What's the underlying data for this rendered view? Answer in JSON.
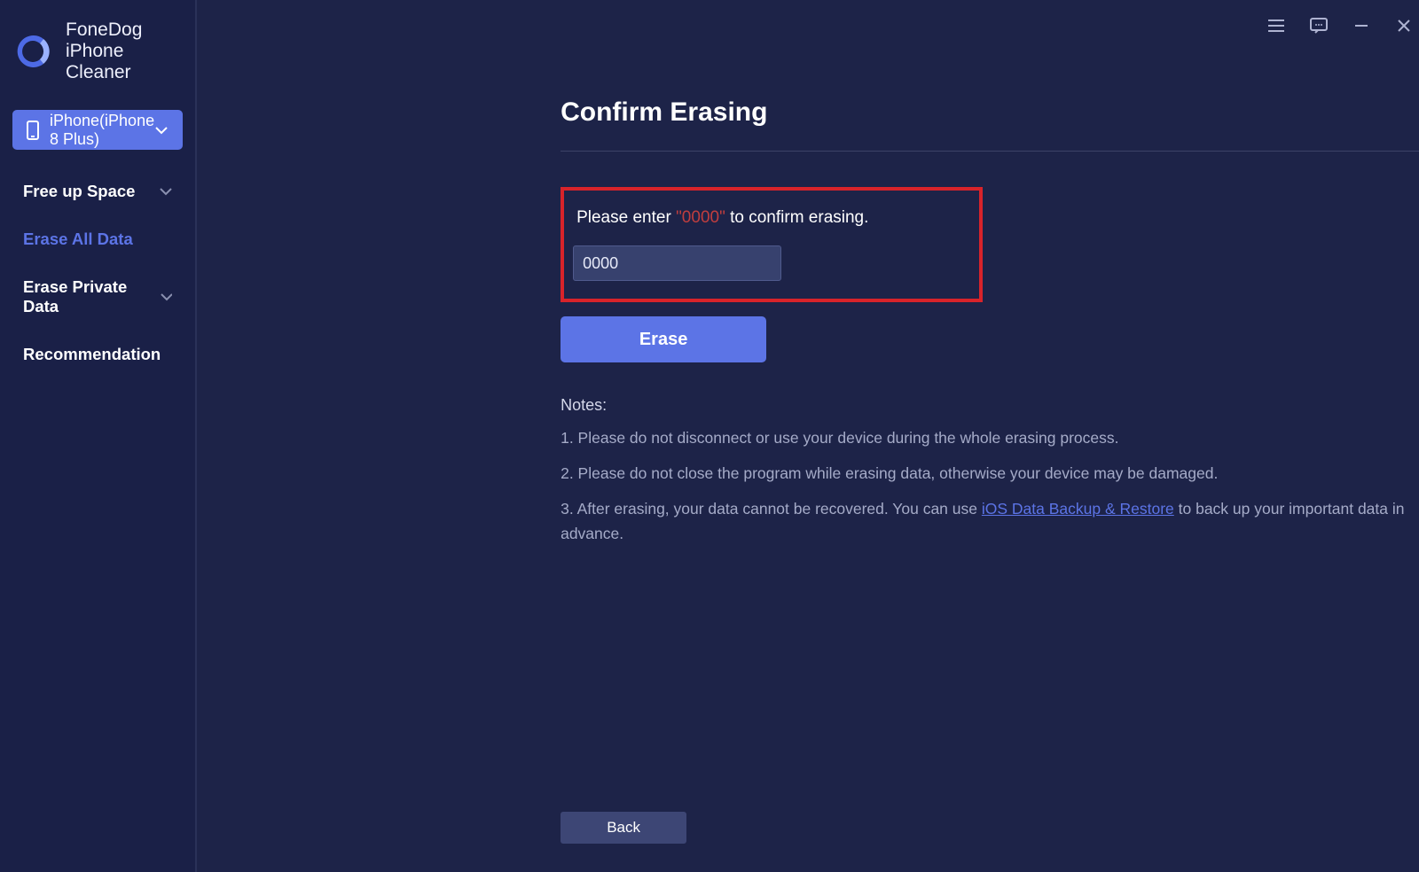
{
  "brand": {
    "title": "FoneDog iPhone Cleaner"
  },
  "device": {
    "label": "iPhone(iPhone 8 Plus)"
  },
  "nav": {
    "freeup": "Free up Space",
    "eraseAll": "Erase All Data",
    "erasePrivate": "Erase Private Data",
    "recommend": "Recommendation"
  },
  "page": {
    "title": "Confirm Erasing"
  },
  "prompt": {
    "pre": "Please enter ",
    "code": "\"0000\"",
    "post": " to confirm erasing."
  },
  "input": {
    "value": "0000"
  },
  "buttons": {
    "erase": "Erase",
    "back": "Back"
  },
  "notes": {
    "title": "Notes:",
    "n1": "1. Please do not disconnect or use your device during the whole erasing process.",
    "n2": "2. Please do not close the program while erasing data, otherwise your device may be damaged.",
    "n3a": "3. After erasing, your data cannot be recovered. You can use ",
    "n3link": "iOS Data Backup & Restore",
    "n3b": " to back up your important data in advance."
  }
}
